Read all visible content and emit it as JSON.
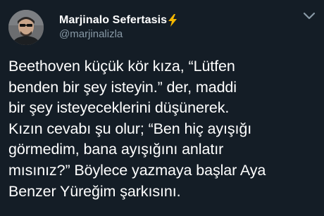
{
  "tweet": {
    "display_name": "Marjinalo Sefertasis",
    "name_emoji_icon": "lightning-bolt-icon",
    "handle": "@marjinalizla",
    "text": "Beethoven küçük kör kıza, “Lütfen\nbenden bir şey isteyin.” der, maddi\nbir şey isteyeceklerini düşünerek.\nKızın cevabı şu olur; “Ben hiç ayışığı\ngörmedim, bana ayışığını anlatır\nmısınız?” Böylece yazmaya başlar Aya\nBenzer Yüreğim şarkısını."
  },
  "icons": {
    "avatar": "user-avatar",
    "menu": "chevron-down-icon"
  },
  "colors": {
    "background": "#141d26",
    "text_primary": "#ffffff",
    "text_secondary": "#8899a6",
    "bolt": "#f5b700"
  }
}
